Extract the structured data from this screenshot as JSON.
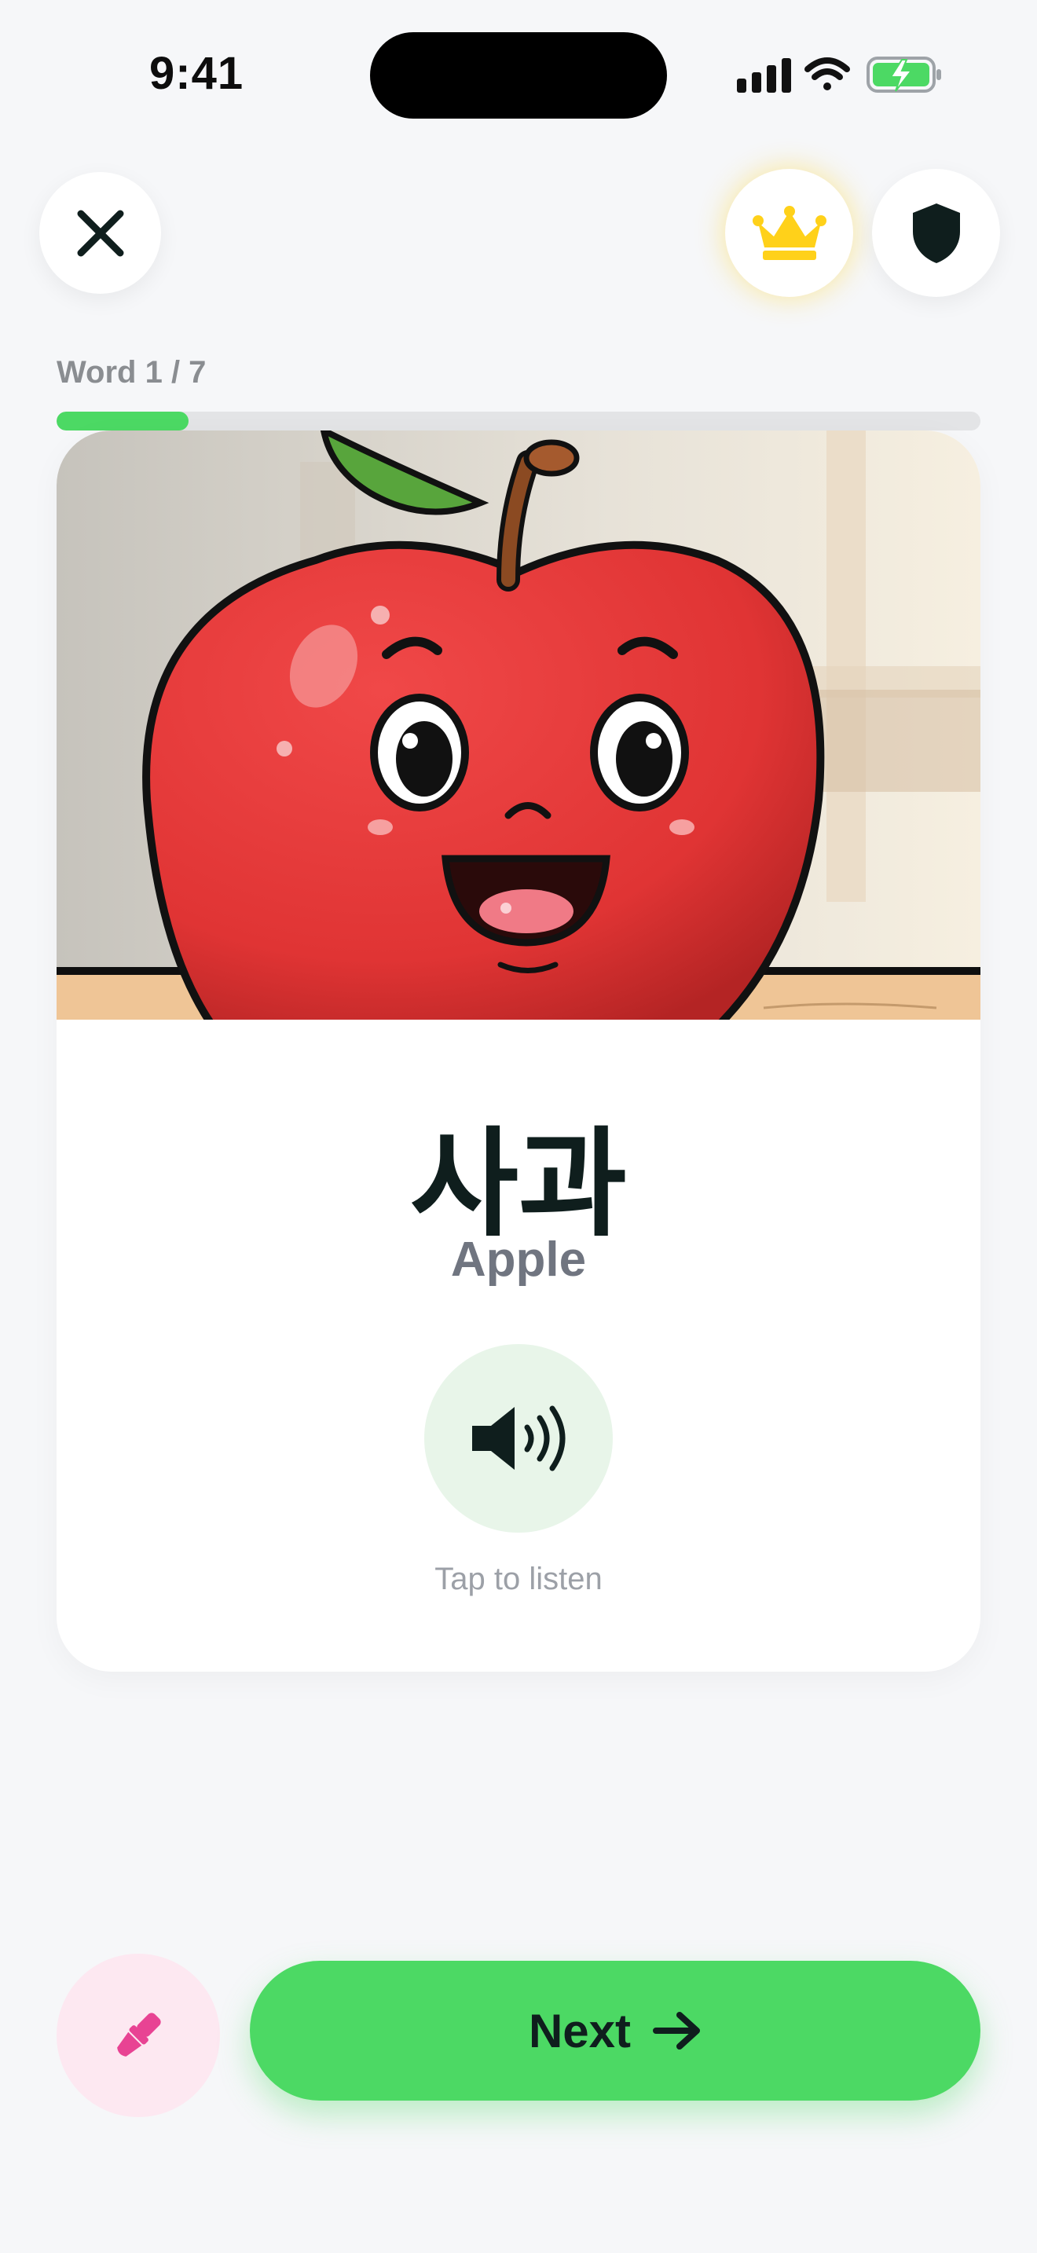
{
  "status_bar": {
    "time": "9:41",
    "icons": [
      "cellular-signal-icon",
      "wifi-icon",
      "battery-charging-icon"
    ]
  },
  "header": {
    "close_icon": "close-icon",
    "premium_icon": "crown-icon",
    "shield_icon": "shield-icon"
  },
  "progress": {
    "label": "Word 1 / 7",
    "current": 1,
    "total": 7
  },
  "card": {
    "image_icon": "apple-illustration",
    "word": "사과",
    "meaning": "Apple",
    "audio_icon": "speaker-icon",
    "tap_hint": "Tap to listen"
  },
  "footer": {
    "edit_icon": "paintbrush-icon",
    "next_label": "Next",
    "next_icon": "arrow-right-icon"
  },
  "colors": {
    "accent_green": "#4cd964",
    "background": "#f6f7f9",
    "crown_gold": "#ffd11a",
    "edit_pink": "#e84393"
  }
}
